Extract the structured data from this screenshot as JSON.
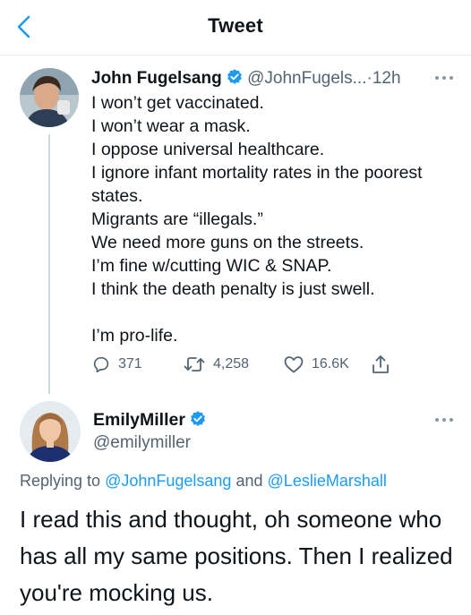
{
  "header": {
    "title": "Tweet"
  },
  "tweet1": {
    "name": "John Fugelsang",
    "handle": "@JohnFugels...",
    "separator": "·",
    "time": "12h",
    "lines": [
      "I won’t get vaccinated.",
      "I won’t wear a mask.",
      "I oppose universal healthcare.",
      "I ignore infant mortality rates in the poorest states.",
      "Migrants are “illegals.”",
      "We need more guns on the streets.",
      "I’m fine w/cutting WIC & SNAP.",
      "I think the death penalty is just swell."
    ],
    "closing": "I’m pro-life.",
    "replies": "371",
    "retweets": "4,258",
    "likes": "16.6K"
  },
  "tweet2": {
    "name": "EmilyMiller",
    "handle": "@emilymiller",
    "replying_prefix": "Replying to",
    "mention1": "@JohnFugelsang",
    "replying_and": "and",
    "mention2": "@LeslieMarshall",
    "text": "I read this and thought, oh someone who has all my same positions. Then I realized you're mocking us."
  },
  "colors": {
    "accent": "#1d9bf0",
    "secondary_text": "#536471",
    "divider": "#e6ecf0"
  },
  "icons": [
    "back-arrow-icon",
    "verified-badge-icon",
    "more-icon",
    "reply-icon",
    "retweet-icon",
    "like-icon",
    "share-icon"
  ]
}
